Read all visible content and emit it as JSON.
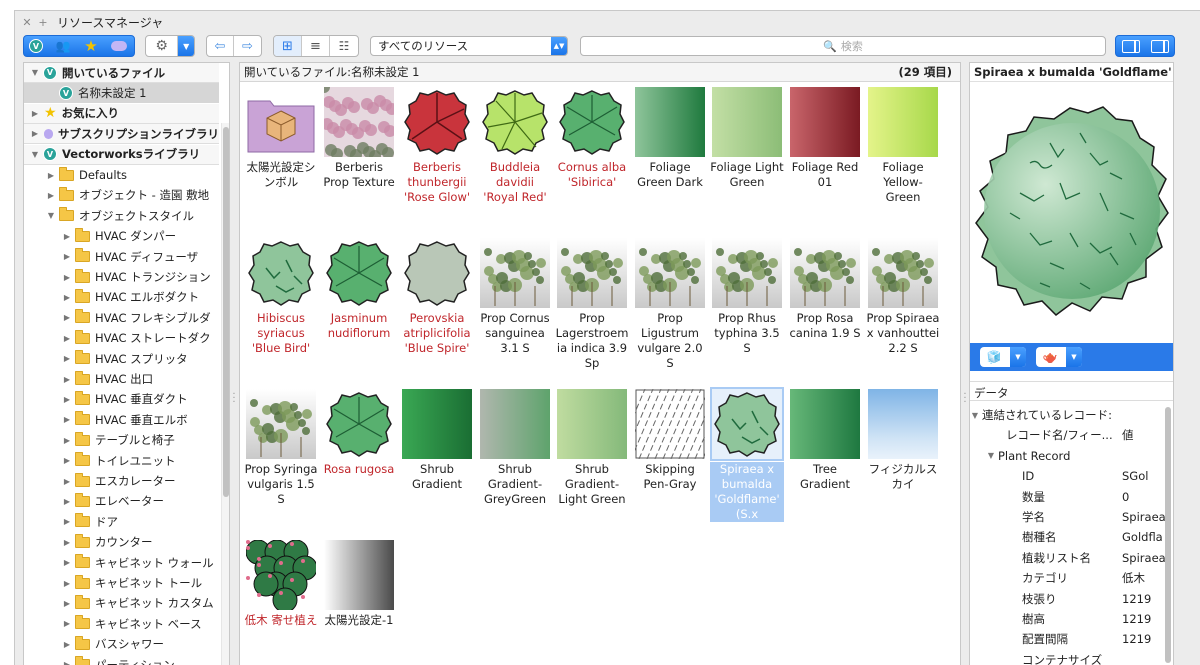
{
  "window": {
    "title": "リソースマネージャ"
  },
  "toolbar": {
    "library_select": "すべてのリソース",
    "search_placeholder": "検索"
  },
  "left_tree": [
    {
      "label": "開いているファイル",
      "level": 0,
      "type": "head",
      "icon": "vectorworks-icon",
      "expanded": true
    },
    {
      "label": "名称未設定 1",
      "level": 1,
      "type": "doc",
      "icon": "vectorworks-icon",
      "selected": true
    },
    {
      "label": "お気に入り",
      "level": 0,
      "type": "head",
      "icon": "star-icon"
    },
    {
      "label": "サブスクリプションライブラリ",
      "level": 0,
      "type": "head",
      "icon": "cloud-icon"
    },
    {
      "label": "Vectorworksライブラリ",
      "level": 0,
      "type": "head",
      "icon": "vectorworks-icon",
      "expanded": true
    },
    {
      "label": "Defaults",
      "level": 1,
      "type": "folder"
    },
    {
      "label": "オブジェクト - 造園 敷地",
      "level": 1,
      "type": "folder"
    },
    {
      "label": "オブジェクトスタイル",
      "level": 1,
      "type": "folder",
      "expanded": true
    },
    {
      "label": "HVAC ダンパー",
      "level": 2,
      "type": "folder"
    },
    {
      "label": "HVAC ディフューザ",
      "level": 2,
      "type": "folder"
    },
    {
      "label": "HVAC トランジション",
      "level": 2,
      "type": "folder"
    },
    {
      "label": "HVAC エルボダクト",
      "level": 2,
      "type": "folder"
    },
    {
      "label": "HVAC フレキシブルダ",
      "level": 2,
      "type": "folder"
    },
    {
      "label": "HVAC ストレートダク",
      "level": 2,
      "type": "folder"
    },
    {
      "label": "HVAC スプリッタ",
      "level": 2,
      "type": "folder"
    },
    {
      "label": "HVAC 出口",
      "level": 2,
      "type": "folder"
    },
    {
      "label": "HVAC 垂直ダクト",
      "level": 2,
      "type": "folder"
    },
    {
      "label": "HVAC 垂直エルボ",
      "level": 2,
      "type": "folder"
    },
    {
      "label": "テーブルと椅子",
      "level": 2,
      "type": "folder"
    },
    {
      "label": "トイレユニット",
      "level": 2,
      "type": "folder"
    },
    {
      "label": "エスカレーター",
      "level": 2,
      "type": "folder"
    },
    {
      "label": "エレベーター",
      "level": 2,
      "type": "folder"
    },
    {
      "label": "ドア",
      "level": 2,
      "type": "folder"
    },
    {
      "label": "カウンター",
      "level": 2,
      "type": "folder"
    },
    {
      "label": "キャビネット ウォール",
      "level": 2,
      "type": "folder"
    },
    {
      "label": "キャビネット トール",
      "level": 2,
      "type": "folder"
    },
    {
      "label": "キャビネット カスタム",
      "level": 2,
      "type": "folder"
    },
    {
      "label": "キャビネット ベース",
      "level": 2,
      "type": "folder"
    },
    {
      "label": "バスシャワー",
      "level": 2,
      "type": "folder"
    },
    {
      "label": "パーティション",
      "level": 2,
      "type": "folder"
    }
  ],
  "center": {
    "header": "開いているファイル:名称未設定 1",
    "count": "(29 項目)",
    "items": [
      {
        "label": "太陽光設定シンボル",
        "kind": "symbol",
        "red": false
      },
      {
        "label": "Berberis Prop Texture",
        "kind": "photo-pink",
        "red": false
      },
      {
        "label": "Berberis thunbergii 'Rose Glow'",
        "kind": "plant-red",
        "red": true
      },
      {
        "label": "Buddleia davidii 'Royal Red'",
        "kind": "plant-lime",
        "red": true
      },
      {
        "label": "Cornus alba 'Sibirica'",
        "kind": "plant-green-star",
        "red": true
      },
      {
        "label": "Foliage Green Dark",
        "kind": "grad",
        "g1": "#8fc59b",
        "g2": "#1f7a3e",
        "red": false
      },
      {
        "label": "Foliage Light Green",
        "kind": "grad",
        "g1": "#c3dfa5",
        "g2": "#8cbd77",
        "red": false
      },
      {
        "label": "Foliage Red 01",
        "kind": "grad",
        "g1": "#c9656b",
        "g2": "#7a1a22",
        "red": false
      },
      {
        "label": "Foliage Yellow-Green",
        "kind": "grad",
        "g1": "#e4f48a",
        "g2": "#a7d84a",
        "red": false
      },
      {
        "label": "Hibiscus syriacus 'Blue Bird'",
        "kind": "plant-blob",
        "red": true
      },
      {
        "label": "Jasminum nudiflorum",
        "kind": "plant-green-star",
        "red": true
      },
      {
        "label": "Perovskia atriplicifolia 'Blue Spire'",
        "kind": "plant-gray",
        "red": true
      },
      {
        "label": "Prop Cornus sanguinea 3.1 S",
        "kind": "photo-shrub",
        "red": false
      },
      {
        "label": "Prop Lagerstroemia indica 3.9 Sp",
        "kind": "photo-shrub",
        "red": false
      },
      {
        "label": "Prop Ligustrum vulgare 2.0 S",
        "kind": "photo-shrub",
        "red": false
      },
      {
        "label": "Prop Rhus typhina 3.5 S",
        "kind": "photo-shrub",
        "red": false
      },
      {
        "label": "Prop Rosa canina 1.9 S",
        "kind": "photo-shrub",
        "red": false
      },
      {
        "label": "Prop Spiraea x vanhouttei 2.2 S",
        "kind": "photo-shrub",
        "red": false
      },
      {
        "label": "Prop Syringa vulgaris 1.5 S",
        "kind": "photo-shrub",
        "red": false
      },
      {
        "label": "Rosa rugosa",
        "kind": "plant-green-star",
        "red": true
      },
      {
        "label": "Shrub Gradient",
        "kind": "grad",
        "g1": "#3aa854",
        "g2": "#1a6e33",
        "red": false
      },
      {
        "label": "Shrub Gradient-GreyGreen",
        "kind": "grad",
        "g1": "#b0b7ae",
        "g2": "#5ea36c",
        "red": false
      },
      {
        "label": "Shrub Gradient-Light Green",
        "kind": "grad",
        "g1": "#c0dca0",
        "g2": "#84b97a",
        "red": false
      },
      {
        "label": "Skipping Pen-Gray",
        "kind": "hatch",
        "red": false
      },
      {
        "label": "Spiraea x bumalda 'Goldflame' (S.x",
        "kind": "plant-blob",
        "red": true,
        "selected": true
      },
      {
        "label": "Tree Gradient",
        "kind": "grad",
        "g1": "#67b879",
        "g2": "#1e7840",
        "red": false
      },
      {
        "label": "フィジカルスカイ",
        "kind": "sky",
        "red": false
      },
      {
        "label": "低木 寄せ植え",
        "kind": "plant-cluster",
        "red": true
      },
      {
        "label": "太陽光設定-1",
        "kind": "grad",
        "g1": "#ffffff",
        "g2": "#4a4a4a",
        "red": false
      }
    ]
  },
  "right": {
    "title": "Spiraea x bumalda 'Goldflame' (S.x",
    "data_title": "データ",
    "rows": [
      {
        "k": "連結されているレコード:",
        "v": "",
        "indent": 0,
        "tri": true
      },
      {
        "k": "レコード名/フィー...",
        "v": "値",
        "indent": 1,
        "tri": false
      },
      {
        "k": "Plant Record",
        "v": "",
        "indent": 1,
        "tri": true
      },
      {
        "k": "ID",
        "v": "SGol",
        "indent": 2,
        "tri": false
      },
      {
        "k": "数量",
        "v": "0",
        "indent": 2,
        "tri": false
      },
      {
        "k": "学名",
        "v": "Spiraea",
        "indent": 2,
        "tri": false
      },
      {
        "k": "樹種名",
        "v": "Goldfla",
        "indent": 2,
        "tri": false
      },
      {
        "k": "植栽リスト名",
        "v": "Spiraea",
        "indent": 2,
        "tri": false
      },
      {
        "k": "カテゴリ",
        "v": "低木",
        "indent": 2,
        "tri": false
      },
      {
        "k": "枝張り",
        "v": "1219",
        "indent": 2,
        "tri": false
      },
      {
        "k": "樹高",
        "v": "1219",
        "indent": 2,
        "tri": false
      },
      {
        "k": "配置間隔",
        "v": "1219",
        "indent": 2,
        "tri": false
      },
      {
        "k": "コンテナサイズ",
        "v": "",
        "indent": 2,
        "tri": false
      }
    ]
  }
}
